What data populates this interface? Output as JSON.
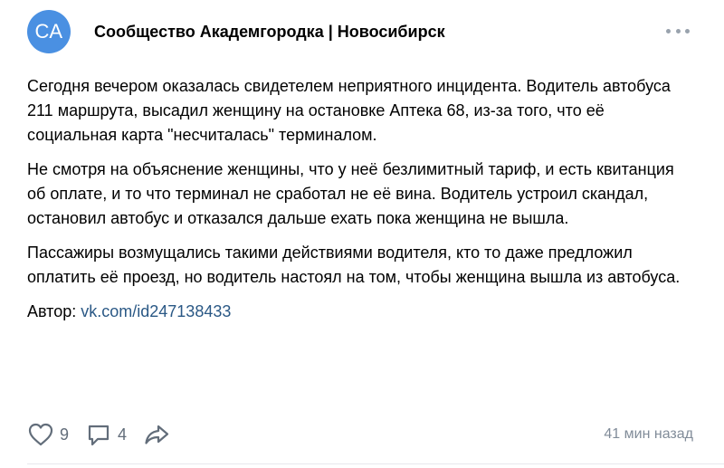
{
  "post": {
    "author": {
      "avatar_initials": "СА",
      "name": "Сообщество Академгородка | Новосибирск"
    },
    "paragraphs": [
      "Сегодня вечером оказалась свидетелем неприятного инцидента. Водитель автобуса 211 маршрута, высадил женщину на остановке Аптека 68, из-за того, что её социальная карта \"несчиталась\" терминалом.",
      "Не смотря на объяснение женщины, что у неё безлимитный тариф, и есть квитанция об оплате, и то что терминал не сработал не её вина. Водитель устроил скандал, остановил автобус и отказался дальше ехать пока женщина не вышла.",
      "Пассажиры возмущались такими действиями водителя, кто то даже предложил оплатить её проезд, но водитель настоял на том, чтобы женщина вышла из автобуса."
    ],
    "author_line": {
      "label": "Автор: ",
      "link_text": "vk.com/id247138433"
    },
    "footer": {
      "likes_count": "9",
      "comments_count": "4",
      "timestamp": "41 мин назад"
    }
  },
  "colors": {
    "avatar_bg": "#4a90e2",
    "link": "#2a5885",
    "meta": "#818c99",
    "icon": "#626d7a"
  },
  "icons": {
    "more": "more-horizontal-icon",
    "like": "heart-icon",
    "comment": "comment-icon",
    "share": "share-arrow-icon"
  }
}
